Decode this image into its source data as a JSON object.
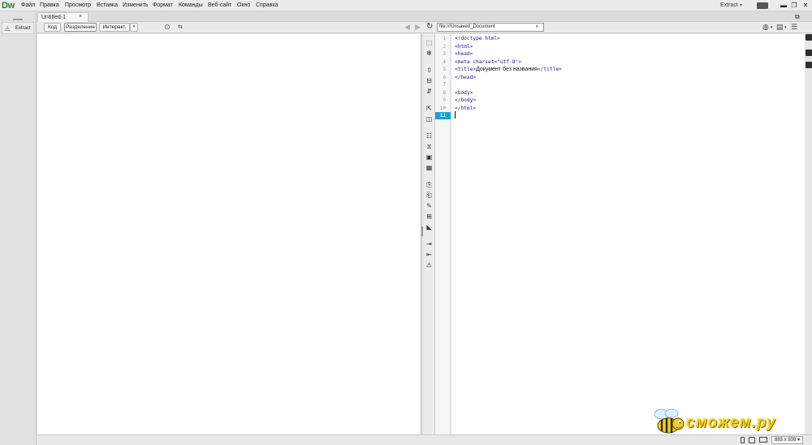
{
  "app": {
    "logo": "Dw",
    "menu": [
      "Файл",
      "Правка",
      "Просмотр",
      "Вставка",
      "Изменить",
      "Формат",
      "Команды",
      "Веб-сайт",
      "Окно",
      "Справка"
    ],
    "workspace": "Extract",
    "workspace_arrow": "▾",
    "window_controls": {
      "minimize": "▬",
      "maximize": "❐",
      "close": "✕"
    }
  },
  "left_panel": {
    "extract_label": "Extract",
    "extract_icon": "extract-icon"
  },
  "document": {
    "tab_title": "Untitled-1",
    "tab_close": "×"
  },
  "toolbar": {
    "code_label": "Код",
    "split_label": "Разделение",
    "live_label": "Интеракт.",
    "live_arrow": "▾",
    "address_value": "file:///Unsaved_Document",
    "address_arrow": "▾"
  },
  "code": {
    "line_numbers": [
      "1",
      "2",
      "3",
      "4",
      "5",
      "6",
      "7",
      "8",
      "9",
      "10",
      "11"
    ],
    "active_line": "11",
    "lines": [
      "<!doctype html>",
      "<html>",
      "<head>",
      "<meta charset=\"utf-8\">",
      "<title>",
      "</head>",
      "",
      "<body>",
      "</body>",
      "</html>",
      ""
    ],
    "title_text": "Документ без названия",
    "title_close": "</title>"
  },
  "watermark": {
    "text": "сможем.ру"
  },
  "statusbar": {
    "size": "893 x 939 ▾"
  },
  "colors": {
    "active_line_bg": "#18a3d8",
    "code_tag": "#1a1a8c",
    "logo_green": "#2e7d32",
    "watermark_yellow": "#f2cf1a"
  }
}
